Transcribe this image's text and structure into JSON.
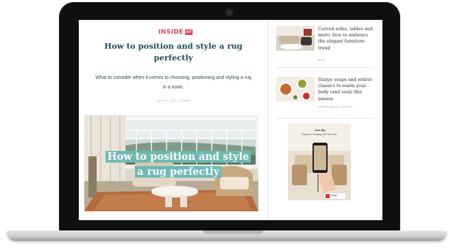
{
  "article": {
    "logo": "INSIDE",
    "logo_badge": "OUT",
    "headline": "How to position and style a rug perfectly",
    "dek": "What to consider when it comes to choosing, positioning and styling a rug in a room.",
    "byline": "AUG 08, 2022 | SUSAN",
    "hero_overlay": "How to position and style a rug perfectly",
    "colors": {
      "logo": "#e43b57",
      "headline": "#1f4d55",
      "overlay_band": "#6fb9b4"
    }
  },
  "sidebar": {
    "cards": [
      {
        "title": "Curved sofas, tables and more: how to embrace the elegant furniture trend",
        "source": "BOLD"
      },
      {
        "title": "Slurpy soups and winter classics to warm your body (and soul) this season",
        "source": "SPONSORED BY CHANGE"
      }
    ],
    "ad": {
      "heading": "Save Big",
      "subheading": "Explore & Shopping with Rowe Buy",
      "brand": "Cluster"
    }
  }
}
